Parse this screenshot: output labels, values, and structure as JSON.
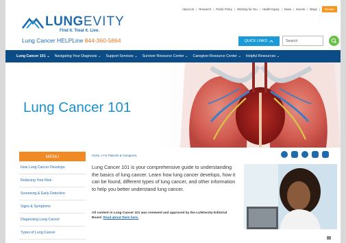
{
  "utility_nav": {
    "links": [
      "About Us",
      "Research",
      "Public Policy",
      "Working for You",
      "Health Equity",
      "News",
      "Events",
      "Blogs"
    ],
    "donate": "Donate"
  },
  "brand": {
    "name_bold": "LUNG",
    "name_light": "EVITY",
    "tagline": "Find it. Treat it. Live."
  },
  "helpline": {
    "label": "Lung Cancer HELPLine ",
    "number": "844-360-5864"
  },
  "quick_links": "QUICK LINKS",
  "search": {
    "placeholder": "Search"
  },
  "main_nav": [
    "Lung Cancer 101",
    "Navigating Your Diagnosis",
    "Support Services",
    "Survivor Resource Center",
    "Caregiver Resource Center",
    "Helpful Resources"
  ],
  "hero": {
    "title": "Lung Cancer 101"
  },
  "menu": {
    "header": "MENU",
    "items": [
      "How Lung Cancer Develops",
      "Reducing Your Risk",
      "Screening & Early Detection",
      "Signs & Symptoms",
      "Diagnosing Lung Cancer",
      "Types of Lung Cancer"
    ]
  },
  "breadcrumb": "Home » For Patients & Caregivers",
  "social_icons": [
    "facebook-icon",
    "instagram-icon",
    "twitter-icon",
    "youtube-icon",
    "linkedin-icon"
  ],
  "intro": "Lung Cancer 101 is your comprehensive guide to understanding the basics of lung cancer. Learn how lung cancer develops, how it can be found, different types of lung cancer, and other information to help you better understand lung cancer.",
  "review_note": {
    "text": "All content in Lung Cancer 101 was reviewed and approved by the LUNGevity Editorial Board. ",
    "link": "Read about them here."
  },
  "colors": {
    "brand_blue": "#1f69ad",
    "nav_blue": "#0b4c86",
    "orange": "#f08a24",
    "green": "#6abf4b"
  }
}
